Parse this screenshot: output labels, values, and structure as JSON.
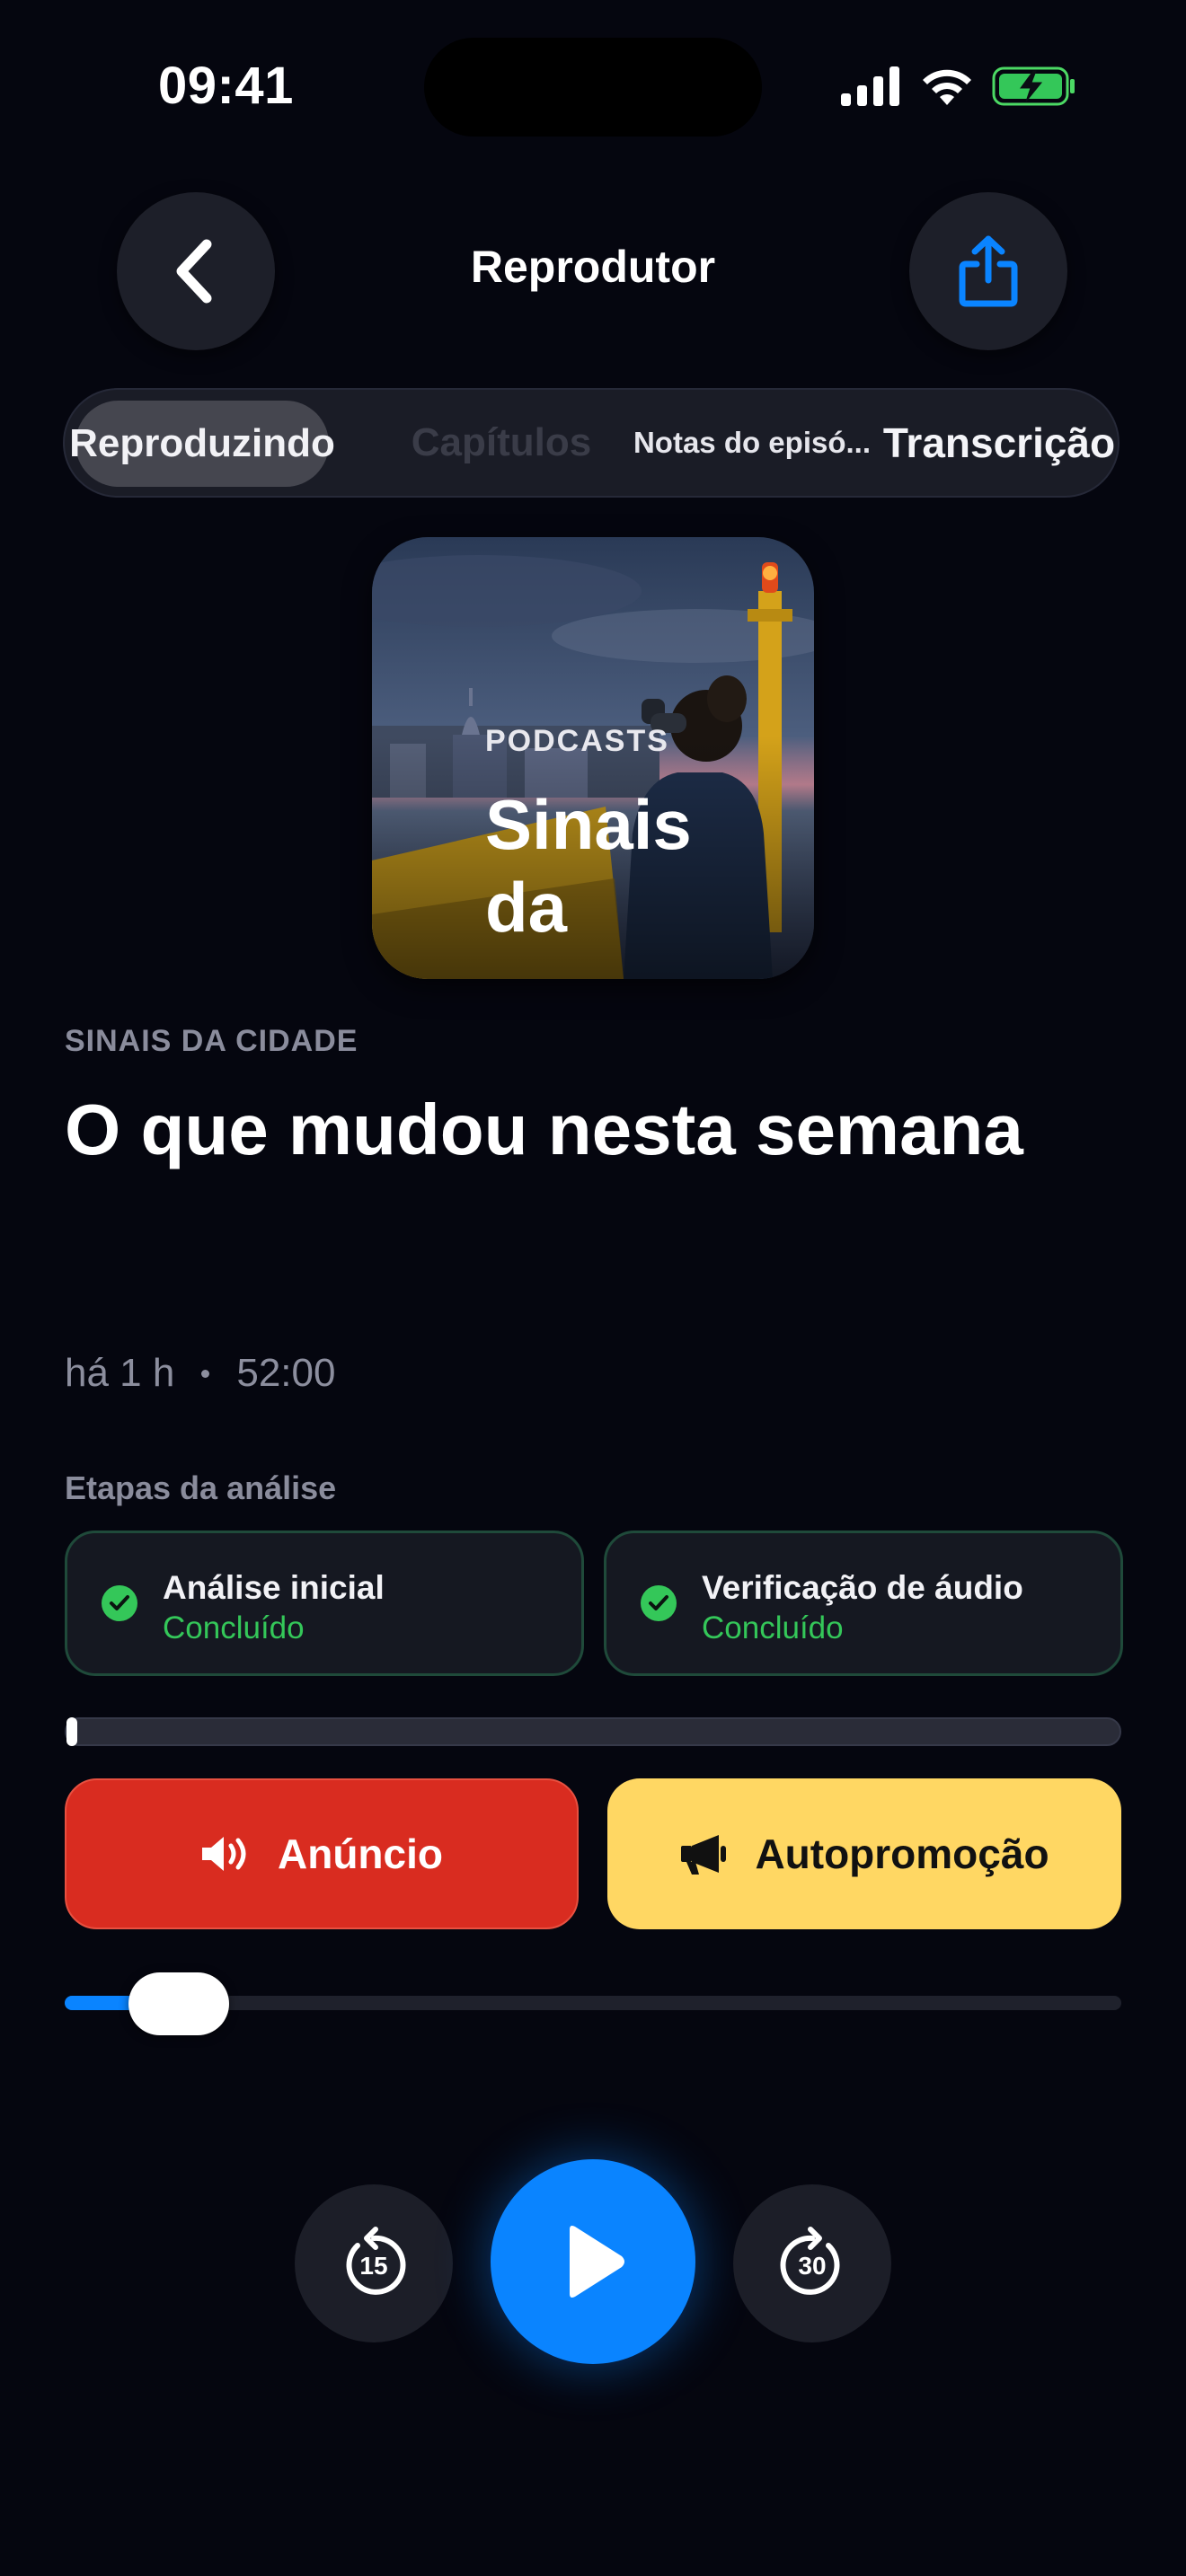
{
  "status_bar": {
    "time": "09:41"
  },
  "nav": {
    "title": "Reprodutor"
  },
  "tabs": [
    {
      "label": "Reproduzindo",
      "active": true
    },
    {
      "label": "Capítulos",
      "active": false
    },
    {
      "label": "Notas do episó...",
      "active": false
    },
    {
      "label": "Transcrição",
      "active": false
    }
  ],
  "artwork": {
    "label": "PODCASTS",
    "title": "Sinais da"
  },
  "episode": {
    "show": "SINAIS DA CIDADE",
    "title": "O que mudou nesta semana",
    "published": "há 1 h",
    "duration": "52:00"
  },
  "analysis": {
    "title": "Etapas da análise",
    "steps": [
      {
        "name": "Análise inicial",
        "status": "Concluído"
      },
      {
        "name": "Verificação de áudio",
        "status": "Concluído"
      }
    ]
  },
  "actions": {
    "ad_label": "Anúncio",
    "promo_label": "Autopromoção"
  },
  "player": {
    "progress_fraction": 0.06,
    "skip_back": "15",
    "skip_forward": "30"
  },
  "colors": {
    "accent": "#0a84ff",
    "ad": "#d92c20",
    "promo": "#ffd763",
    "success": "#34c759",
    "background": "#05060f"
  }
}
